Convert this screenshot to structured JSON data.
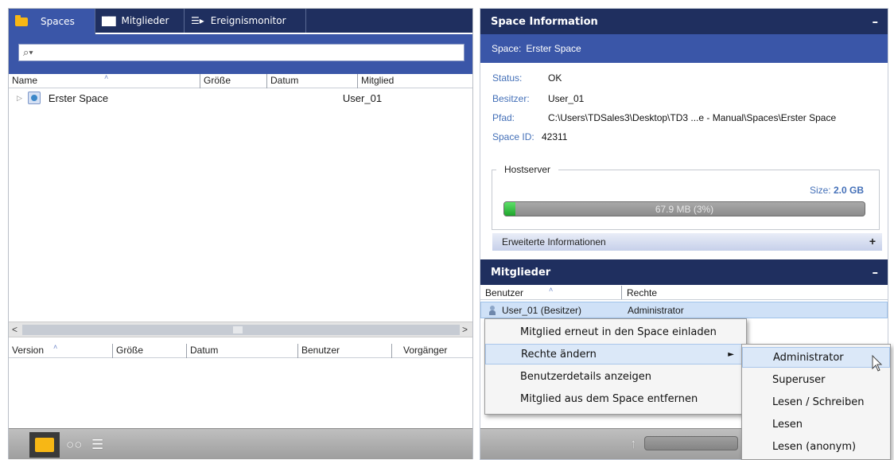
{
  "tabs": [
    {
      "label": "Spaces",
      "icon": "folder-icon"
    },
    {
      "label": "Mitglieder",
      "icon": "members-icon"
    },
    {
      "label": "Ereignismonitor",
      "icon": "event-monitor-icon"
    }
  ],
  "search": {
    "icon": "search-icon",
    "value": ""
  },
  "spaces_table": {
    "columns": [
      "Name",
      "Größe",
      "Datum",
      "Mitglied"
    ],
    "rows": [
      {
        "name": "Erster Space",
        "size": "",
        "date": "",
        "member": "User_01"
      }
    ]
  },
  "versions_table": {
    "columns": [
      "Version",
      "Größe",
      "Datum",
      "Benutzer",
      "Vorgänger"
    ]
  },
  "scroll": {
    "left": "<",
    "right": ">"
  },
  "space_info": {
    "header": "Space Information",
    "collapse": "–",
    "space_label": "Space:",
    "space_name": "Erster Space",
    "fields": {
      "status_label": "Status:",
      "status": "OK",
      "owner_label": "Besitzer:",
      "owner": "User_01",
      "path_label": "Pfad:",
      "path": "C:\\Users\\TDSales3\\Desktop\\TD3 ...e - Manual\\Spaces\\Erster Space",
      "id_label": "Space ID:",
      "id": "42311"
    },
    "host": {
      "legend": "Hostserver",
      "size_label": "Size:",
      "size_value": "2.0 GB",
      "usage_text": "67.9 MB (3%)",
      "usage_fraction": 0.03
    },
    "extended": "Erweiterte Informationen",
    "extended_toggle": "+"
  },
  "members": {
    "header": "Mitglieder",
    "collapse": "–",
    "columns": [
      "Benutzer",
      "Rechte"
    ],
    "rows": [
      {
        "user": "User_01 (Besitzer)",
        "rights": "Administrator"
      }
    ]
  },
  "context_menu": {
    "items": [
      "Mitglied erneut in den Space einladen",
      "Rechte ändern",
      "Benutzerdetails anzeigen",
      "Mitglied aus dem Space entfernen"
    ],
    "highlighted": "Rechte ändern",
    "submenu_arrow": "►"
  },
  "rights_submenu": {
    "items": [
      "Administrator",
      "Superuser",
      "Lesen / Schreiben",
      "Lesen",
      "Lesen (anonym)"
    ],
    "highlighted": "Administrator"
  },
  "bottom_icons": [
    "folder-icon",
    "members-icon",
    "event-monitor-icon"
  ],
  "upload_icon": "↑",
  "colors": {
    "navy": "#1f2f5f",
    "blue": "#3a56a8",
    "accent_folder": "#f7b715",
    "progress_green": "#1fa52c"
  }
}
